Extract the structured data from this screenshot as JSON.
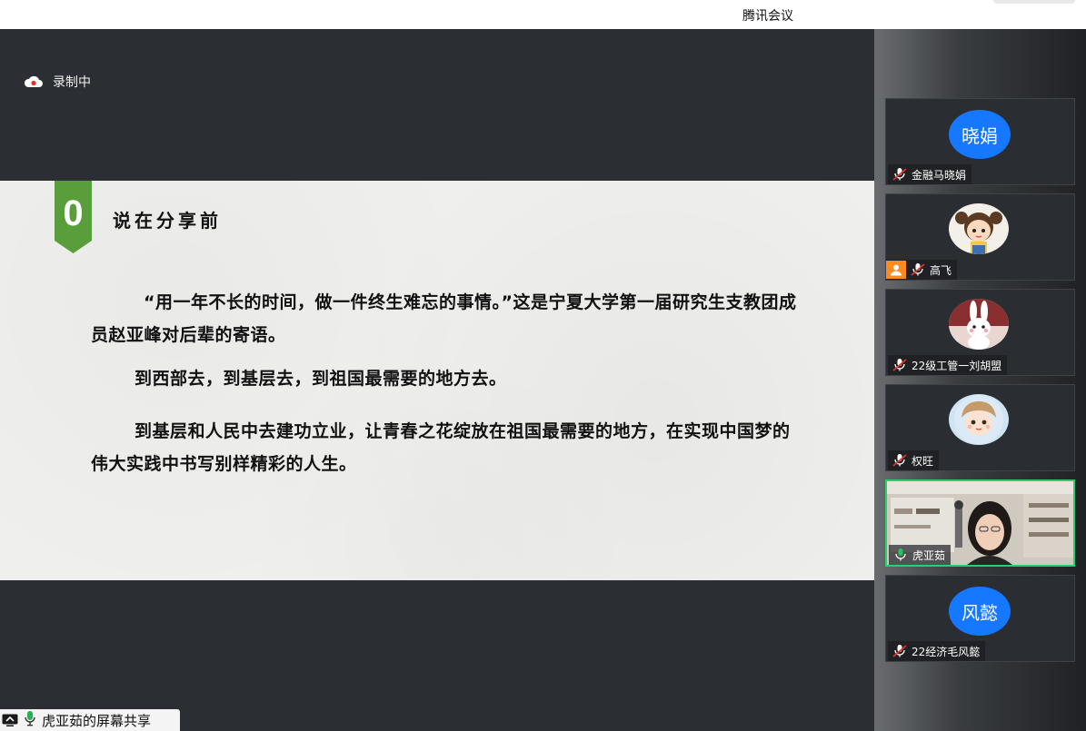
{
  "window": {
    "title": "腾讯会议"
  },
  "stage": {
    "recording_label": "录制中",
    "share_label": "虎亚茹的屏幕共享"
  },
  "slide": {
    "badge_number": "0",
    "heading": "说在分享前",
    "paragraphs": [
      "“用一年不长的时间，做一件终生难忘的事情。”这是宁夏大学第一届研究生支教团成员赵亚峰对后辈的寄语。",
      "到西部去，到基层去，到祖国最需要的地方去。",
      "到基层和人民中去建功立业，让青春之花绽放在祖国最需要的地方，在实现中国梦的伟大实践中书写别样精彩的人生。"
    ],
    "accent_color": "#5a9e3c"
  },
  "participants": [
    {
      "name": "金融马晓娟",
      "avatar_text": "晓娟",
      "avatar_type": "blue-circle",
      "mic": "muted"
    },
    {
      "name": "高飞",
      "avatar_type": "cartoon-girl",
      "mic": "muted",
      "host": true
    },
    {
      "name": "22级工管一刘胡盟",
      "avatar_type": "cartoon-rabbit",
      "mic": "muted"
    },
    {
      "name": "权旺",
      "avatar_type": "cartoon-boy",
      "mic": "muted"
    },
    {
      "name": "虎亚茹",
      "avatar_type": "live-video",
      "mic": "active"
    },
    {
      "name": "22经济毛风懿",
      "avatar_text": "风懿",
      "avatar_type": "blue-circle",
      "mic": "muted"
    }
  ],
  "colors": {
    "avatar_blue": "#1677ff",
    "active_border": "#2ecc71",
    "host_orange": "#ff8a1e"
  }
}
